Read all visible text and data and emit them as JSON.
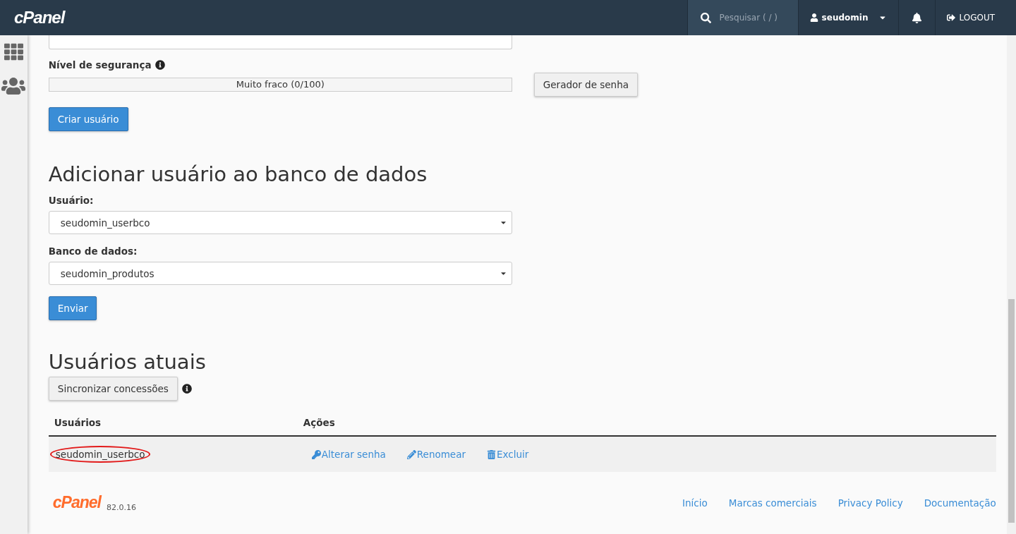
{
  "topbar": {
    "logo": "cPanel",
    "search": {
      "placeholder": "Pesquisar ( / )"
    },
    "user": "seudomin",
    "logout": "LOGOUT"
  },
  "create_user": {
    "strength_label": "Nível de segurança",
    "strength": {
      "level": 0,
      "reading": "Muito fraco (0/100)"
    },
    "generator_button": "Gerador de senha",
    "submit": "Criar usuário"
  },
  "add_user": {
    "title": "Adicionar usuário ao banco de dados",
    "fields": [
      {
        "label": "Usuário:",
        "value": "seudomin_userbco"
      },
      {
        "label": "Banco de dados:",
        "value": "seudomin_produtos"
      }
    ],
    "submit": "Enviar"
  },
  "current_users": {
    "title": "Usuários atuais",
    "sync_button": "Sincronizar concessões",
    "table": {
      "columns": [
        "Usuários",
        "Ações"
      ],
      "rows": [
        {
          "user": "seudomin_userbco",
          "highlighted": true,
          "actions": [
            {
              "kind": "password",
              "label": "Alterar senha"
            },
            {
              "kind": "rename",
              "label": "Renomear"
            },
            {
              "kind": "delete",
              "label": "Excluir"
            }
          ]
        }
      ]
    }
  },
  "footer": {
    "logo": "cPanel",
    "version": "82.0.16",
    "links": [
      "Início",
      "Marcas comerciais",
      "Privacy Policy",
      "Documentação"
    ]
  }
}
